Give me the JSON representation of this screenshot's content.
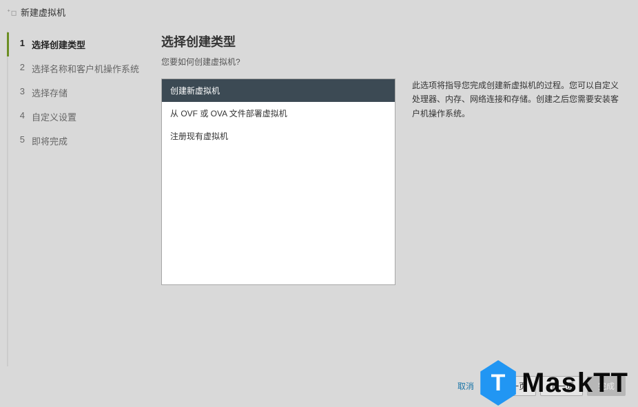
{
  "header": {
    "title": "新建虚拟机"
  },
  "wizard": {
    "steps": [
      {
        "num": "1",
        "label": "选择创建类型"
      },
      {
        "num": "2",
        "label": "选择名称和客户机操作系统"
      },
      {
        "num": "3",
        "label": "选择存储"
      },
      {
        "num": "4",
        "label": "自定义设置"
      },
      {
        "num": "5",
        "label": "即将完成"
      }
    ]
  },
  "main": {
    "title": "选择创建类型",
    "subtitle": "您要如何创建虚拟机?",
    "options": [
      "创建新虚拟机",
      "从 OVF 或 OVA 文件部署虚拟机",
      "注册现有虚拟机"
    ],
    "description": "此选项将指导您完成创建新虚拟机的过程。您可以自定义处理器、内存、网络连接和存储。创建之后您需要安装客户机操作系统。"
  },
  "footer": {
    "cancel": "取消",
    "back": "上一页",
    "next": "下一页",
    "finish": "完成"
  },
  "watermark": {
    "hex": "T",
    "text": "MaskTT"
  }
}
